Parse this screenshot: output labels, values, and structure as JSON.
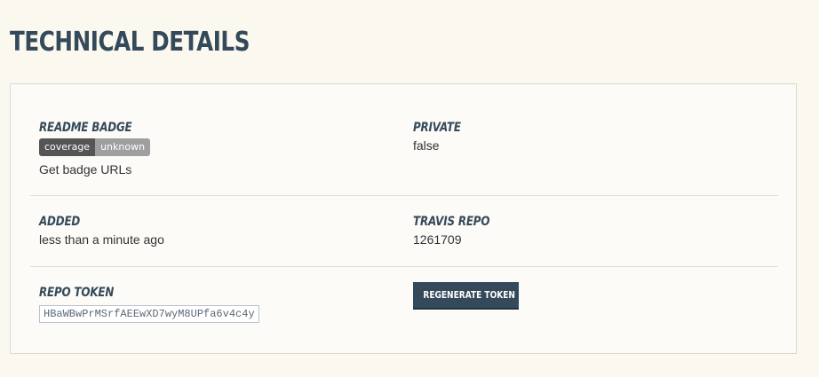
{
  "page": {
    "title": "TECHNICAL DETAILS"
  },
  "details": {
    "readme_badge": {
      "label": "README BADGE",
      "badge_left": "coverage",
      "badge_right": "unknown",
      "link_text": "Get badge URLs"
    },
    "private": {
      "label": "PRIVATE",
      "value": "false"
    },
    "added": {
      "label": "ADDED",
      "value": "less than a minute ago"
    },
    "travis_repo": {
      "label": "TRAVIS REPO",
      "value": "1261709"
    },
    "repo_token": {
      "label": "REPO TOKEN",
      "value": "HBaWBwPrMSrfAEEwXD7wyM8UPfa6v4c4y"
    },
    "regenerate_button": {
      "label": "REGENERATE TOKEN"
    }
  },
  "colors": {
    "background": "#fbf8ef",
    "heading": "#34495a",
    "button": "#34495a",
    "badge_left": "#555555",
    "badge_right": "#9f9f9f"
  }
}
